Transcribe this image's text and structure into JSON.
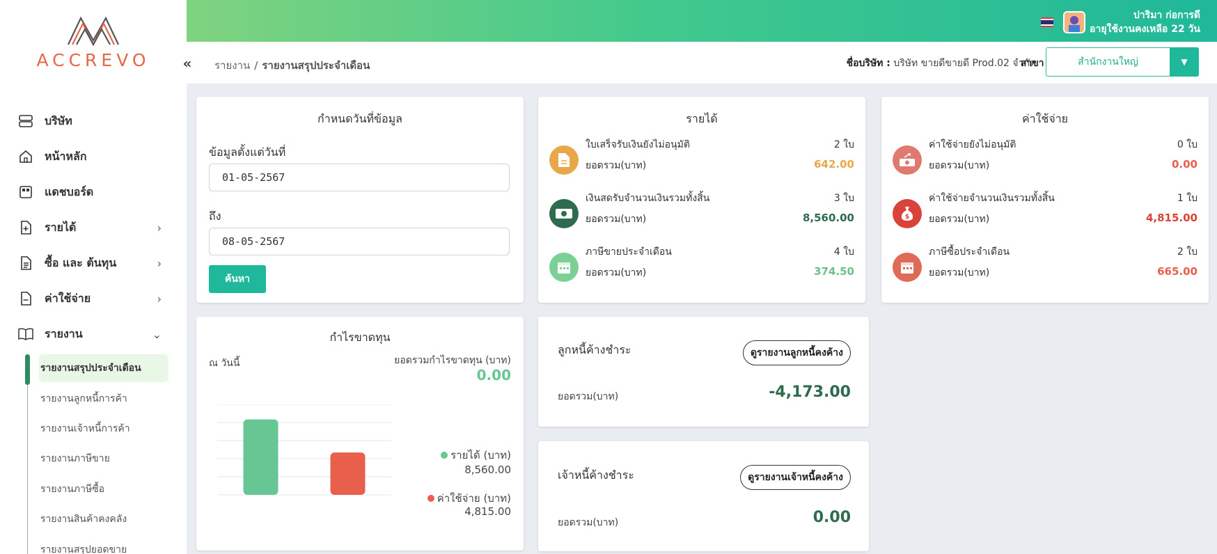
{
  "colors": {
    "accent": "#1fb89a",
    "income_green": "#4caf7a",
    "expense_red": "#e85e4a",
    "orange": "#e8a84a",
    "bar_income": "#66c795",
    "bar_expense": "#e8604c"
  },
  "brand": {
    "logo_text": "ACCREVO"
  },
  "topbar": {
    "user_name": "ปาริมา ก่อการดี",
    "license_text": "อายุใช้งานคงเหลือ 22 วัน"
  },
  "breadcrumb": {
    "collapse_icon": "«",
    "parent": "รายงาน",
    "separator": "/",
    "current": "รายงานสรุปประจำเดือน"
  },
  "company": {
    "label": "ชื่อบริษัท :",
    "value": "บริษัท ขายดีขายดี Prod.02 จำกัด",
    "branch_label": "สาขา :",
    "branch_value": "สำนักงานใหญ่"
  },
  "sidebar": {
    "items": [
      {
        "label": "บริษัท",
        "icon": "server-icon"
      },
      {
        "label": "หน้าหลัก",
        "icon": "home-icon"
      },
      {
        "label": "แดชบอร์ด",
        "icon": "dashboard-icon"
      },
      {
        "label": "รายได้",
        "icon": "income-doc-icon",
        "arrow": "›"
      },
      {
        "label": "ซื้อ และ ต้นทุน",
        "icon": "purchase-doc-icon",
        "arrow": "›"
      },
      {
        "label": "ค่าใช้จ่าย",
        "icon": "expense-doc-icon",
        "arrow": "›"
      },
      {
        "label": "รายงาน",
        "icon": "book-icon",
        "arrow": "⌄"
      }
    ],
    "report_subitems": [
      "รายงานสรุปประจำเดือน",
      "รายงานลูกหนี้การค้า",
      "รายงานเจ้าหนี้การค้า",
      "รายงานภาษีขาย",
      "รายงานภาษีซื้อ",
      "รายงานสินค้าคงคลัง",
      "รายงานสรุปยอดขาย"
    ]
  },
  "date_card": {
    "title": "กำหนดวันที่ข้อมูล",
    "from_label": "ข้อมูลตั้งแต่วันที่",
    "from_value": "01-05-2567",
    "to_label": "ถึง",
    "to_value": "08-05-2567",
    "search_label": "ค้นหา"
  },
  "income_card": {
    "title": "รายได้",
    "rows": [
      {
        "name": "ใบเสร็จรับเงินยังไม่อนุมัติ",
        "count": "2 ใบ",
        "sub": "ยอดรวม(บาท)",
        "amount": "642.00",
        "icon": "document-icon"
      },
      {
        "name": "เงินสดรับจำนวนเงินรวมทั้งสิ้น",
        "count": "3 ใบ",
        "sub": "ยอดรวม(บาท)",
        "amount": "8,560.00",
        "icon": "cash-icon"
      },
      {
        "name": "ภาษีขายประจำเดือน",
        "count": "4 ใบ",
        "sub": "ยอดรวม(บาท)",
        "amount": "374.50",
        "icon": "calendar-icon"
      }
    ]
  },
  "expense_card": {
    "title": "ค่าใช้จ่าย",
    "rows": [
      {
        "name": "ค่าใช้จ่ายยังไม่อนุมัติ",
        "count": "0 ใบ",
        "sub": "ยอดรวม(บาท)",
        "amount": "0.00",
        "icon": "money-out-icon"
      },
      {
        "name": "ค่าใช้จ่ายจำนวนเงินรวมทั้งสิ้น",
        "count": "1 ใบ",
        "sub": "ยอดรวม(บาท)",
        "amount": "4,815.00",
        "icon": "money-bag-icon"
      },
      {
        "name": "ภาษีซื้อประจำเดือน",
        "count": "2 ใบ",
        "sub": "ยอดรวม(บาท)",
        "amount": "665.00",
        "icon": "calendar-icon"
      }
    ]
  },
  "profit_card": {
    "title": "กำไรขาดทุน",
    "as_of": "ณ วันนี้",
    "total_label": "ยอดรวมกำไรขาดทุน (บาท)",
    "total_value": "0.00",
    "legend": [
      {
        "name": "รายได้ (บาท)",
        "value": "8,560.00"
      },
      {
        "name": "ค่าใช้จ่าย (บาท)",
        "value": "4,815.00"
      }
    ]
  },
  "receivable_card": {
    "title": "ลูกหนี้ค้างชำระ",
    "button": "ดูรายงานลูกหนี้คงค้าง",
    "sub": "ยอดรวม(บาท)",
    "amount": "-4,173.00"
  },
  "payable_card": {
    "title": "เจ้าหนี้ค้างชำระ",
    "button": "ดูรายงานเจ้าหนี้คงค้าง",
    "sub": "ยอดรวม(บาท)",
    "amount": "0.00"
  },
  "chart_data": {
    "type": "bar",
    "categories": [
      "รายได้ (บาท)",
      "ค่าใช้จ่าย (บาท)"
    ],
    "values": [
      8560,
      4815
    ],
    "colors": [
      "#66c795",
      "#e8604c"
    ],
    "grid": true,
    "legend": "right"
  }
}
